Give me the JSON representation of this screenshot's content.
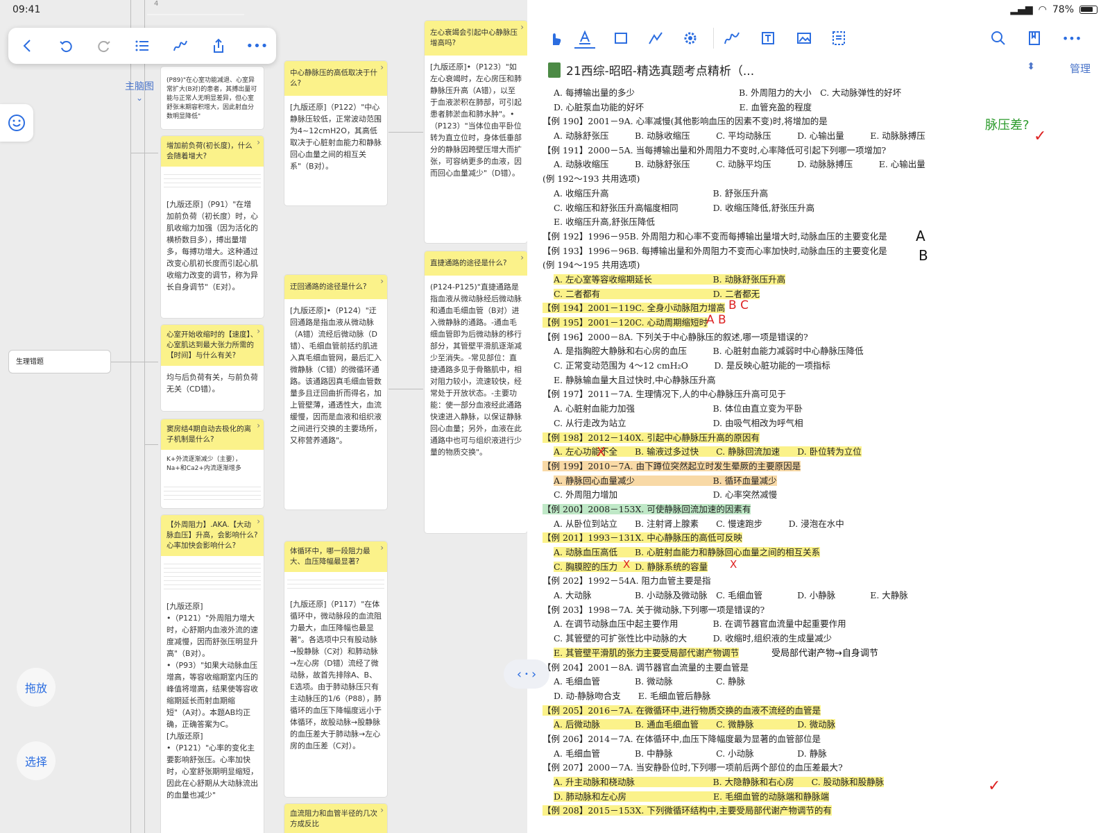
{
  "status": {
    "time": "09:41",
    "battery": "78%"
  },
  "canvas": {
    "mindmap_label": "主脑图",
    "topic_node": "生理错题",
    "drag_button": "拖放",
    "select_button": "选择",
    "top_number": "4"
  },
  "cards": {
    "c1": {
      "q": "",
      "a": "(P89)\"在心室功能减退、心室异常扩大(B对)的患者，其搏出量可能与正常人无明显差异，但心室舒张末期容积增大，因此射血分数明显降低\""
    },
    "c2": {
      "q": "增加前负荷(初长度)，什么会随着增大?",
      "a": "[九版还原]（P91）\"在增加前负荷（初长度）时，心肌收缩力加强（因为活化的横桥数目多），搏出量增多，每搏功增大。这种通过改变心肌初长度而引起心肌收缩力改变的调节，称为异长自身调节\"（E对）。"
    },
    "c3": {
      "q": "心室开始收缩时的【速度】、心室肌达到最大张力所需的【时间】与什么有关?",
      "a": "均与后负荷有关，与前负荷无关（CD错）。"
    },
    "c4": {
      "q": "窦房结4期自动去极化的离子机制是什么?",
      "a": "K+外流逐渐减少（主要），Na+和Ca2+内流逐渐增多"
    },
    "c5": {
      "q": "【外周阻力】.AKA.【大动脉血压】升高，会影响什么? 心率加快会影响什么?",
      "a1": "[九版还原]",
      "a2": "•（P121）\"外周阻力增大时，心舒期内血液外流的速度减慢，因而舒张压明显升高\"（B对）。",
      "a3": "•（P93）\"如果大动脉血压增高，等容收缩期室内压的峰值将增高，结果使等容收缩期延长而射血期缩短\"（A对）。本题AB均正确，正确答案为C。",
      "a4": "[九版还原]",
      "a5": "•（P121）\"心率的变化主要影响舒张压。心率加快时，心室舒张期明显缩短，因此在心舒期从大动脉流出的血量也减少\""
    },
    "c6": {
      "q": "中心静脉压的高低取决于什么?",
      "a": "[九版还原]（P122）\"中心静脉压较低，正常波动范围为4~12cmH2O，其高低取决于心脏射血能力和静脉回心血量之间的相互关系\"（B对）。"
    },
    "c7": {
      "q": "迂回通路的途径是什么?",
      "a": "[九版还原]•（P124）\"迂回通路是指血液从微动脉（A错）流经后微动脉（D错）、毛细血管前括约肌进入真毛细血管网，最后汇入微静脉（C错）的微循环通路。该通路因真毛细血管数量多且迂回曲折而得名，加上管壁薄，通透性大，血流缓慢，因而是血液和组织液之间进行交换的主要场所，又称营养通路\"。"
    },
    "c8": {
      "q": "体循环中，哪一段阻力最大、血压降幅最显著?",
      "a": "[九版还原]（P117）\"在体循环中，微动脉段的血流阻力最大，血压降幅也最显著\"。各选项中只有股动脉→股静脉（C对）和肺动脉→左心房（D错）流经了微动脉，故首先排除A、B、E选项。由于肺动脉压只有主动脉压的1/6（P88），肺循环的血压下降幅度远小于体循环，故股动脉→股静脉的血压差大于肺动脉→左心房的血压差（C对）。"
    },
    "c9": {
      "q": "血流阻力和血管半径的几次方成反比",
      "a": ""
    },
    "c10": {
      "q": "左心衰竭会引起中心静脉压增高吗?",
      "a": "[九版还原]•（P123）\"如左心衰竭时，左心房压和肺静脉压升高（A错），以至于血液淤积在肺部，可引起患者肺淤血和肺水肿\"。•（P123）\"当体位由平卧位转为直立位时，身体低垂部分的静脉因跨壁压增大而扩张，可容纳更多的血液，因而回心血量减少\"（D错）。"
    },
    "c11": {
      "q": "直捷通路的途径是什么?",
      "a": "(P124-P125)\"直捷通路是指血液从微动脉经后微动脉和通血毛细血管（B对）进入微静脉的通路。-通血毛细血管即为后微动脉的移行部分，其管壁平滑肌逐渐减少至消失。-常见部位：直捷通路多见于骨骼肌中，相对阻力较小，流速较快，经常处于开放状态。-主要功能：使一部分血液经此通路快速进入静脉，以保证静脉回心血量；另外，血液在此通路中也可与组织液进行少量的物质交换\"。"
    }
  },
  "pdf": {
    "title": "21西综-昭昭-精选真题考点精析（...",
    "manage": "管理",
    "lines": [
      "A. 每搏输出量的多少　　　　　　　　　　　　B. 外周阻力的大小　C. 大动脉弹性的好坏",
      "D. 心脏泵血功能的好坏　　　　　　　　　　　E. 血管充盈的程度",
      "【例 190】2001－9A. 心率减慢(其他影响血压的因素不变)时,将增加的是",
      "A. 动脉舒张压　　　B. 动脉收缩压　　　C. 平均动脉压　　　D. 心输出量　　　E. 动脉脉搏压",
      "【例 191】2000－5A. 当每搏输出量和外周阻力不变时,心率降低可引起下列哪一项增加?",
      "A. 动脉收缩压　　　B. 动脉舒张压　　　C. 动脉平均压　　　D. 动脉脉搏压　　　E. 心输出量",
      "(例 192～193 共用选项)",
      "A. 收缩压升高　　　　　　　　　　　　B. 舒张压升高",
      "C. 收缩压和舒张压升高幅度相同　　　　D. 收缩压降低,舒张压升高",
      "E. 收缩压升高,舒张压降低",
      "【例 192】1996－95B. 外周阻力和心率不变而每搏输出量增大时,动脉血压的主要变化是",
      "【例 193】1996－96B. 每搏输出量和外周阻力不变而心率加快时,动脉血压的主要变化是",
      "(例 194～195 共用选项)",
      "A. 左心室等容收缩期延长　　　　　　　B. 动脉舒张压升高",
      "C. 二者都有　　　　　　　　　　　　　D. 二者都无",
      "【例 194】2001－119C. 全身小动脉阻力增高",
      "【例 195】2001－120C. 心动周期缩短时",
      "【例 196】2000－8A. 下列关于中心静脉压的叙述,哪一项是错误的?",
      "A. 是指胸腔大静脉和右心房的血压　　　B. 心脏射血能力减弱时中心静脉压降低",
      "C. 正常变动范围为 4～12 cmH₂O　　　D. 是反映心脏功能的一项指标",
      "E. 静脉输血量大且过快时,中心静脉压升高",
      "【例 197】2011－7A. 生理情况下,人的中心静脉压升高可见于",
      "A. 心脏射血能力加强　　　　　　　　　B. 体位由直立变为平卧",
      "C. 从行走改为站立　　　　　　　　　　D. 由吸气相改为呼气相",
      "【例 198】2012－140X. 引起中心静脉压升高的原因有",
      "A. 左心功能不全　　B. 输液过多过快　　C. 静脉回流加速　　D. 卧位转为立位",
      "【例 199】2010－7A. 由下蹲位突然起立时发生晕厥的主要原因是",
      "A. 静脉回心血量减少　　　　　　　　　B. 循环血量减少",
      "C. 外周阻力增加　　　　　　　　　　　D. 心率突然减慢",
      "【例 200】2008－153X. 可使静脉回流加速的因素有",
      "A. 从卧位到站立　　B. 注射肾上腺素　　C. 慢速跑步　　　D. 浸泡在水中",
      "【例 201】1993－131X. 中心静脉压的高低可反映",
      "A. 动脉血压高低　　B. 心脏射血能力和静脉回心血量之间的相互关系",
      "C. 胸膜腔的压力　　D. 静脉系统的容量",
      "【例 202】1992－54A. 阻力血管主要是指",
      "A. 大动脉　　　　　B. 小动脉及微动脉　C. 毛细血管　　　　D. 小静脉　　　　E. 大静脉",
      "【例 203】1998－7A. 关于微动脉,下列哪一项是错误的?",
      "A. 在调节动脉血压中起主要作用　　　　B. 在调节器官血流量中起重要作用",
      "C. 其管壁的可扩张性比中动脉的大　　　D. 收缩时,组织液的生成量减少",
      "E. 其管壁平滑肌的张力主要受局部代谢产物调节",
      "【例 204】2001－8A. 调节器官血流量的主要血管是",
      "A. 毛细血管　　　　B. 微动脉　　　　　C. 静脉",
      "D. 动-静脉吻合支　　E. 毛细血管后静脉",
      "【例 205】2016－7A. 在微循环中,进行物质交换的血液不流经的血管是",
      "A. 后微动脉　　　　B. 通血毛细血管　　C. 微静脉　　　　　D. 微动脉",
      "【例 206】2014－7A. 在体循环中,血压下降幅度最为显著的血管部位是",
      "A. 毛细血管　　　　B. 中静脉　　　　　C. 小动脉　　　　　D. 静脉",
      "【例 207】2000－7A. 当安静卧位时,下列哪一项前后两个部位的血压差最大?",
      "A. 升主动脉和桡动脉　　　　　　　　　B. 大隐静脉和右心房　　C. 股动脉和股静脉",
      "D. 肺动脉和左心房　　　　　　　　　　E. 毛细血管的动脉端和静脉端",
      "【例 208】2015－153X. 下列微循环结构中,主要受局部代谢产物调节的有"
    ],
    "ink": {
      "pulse": "脉压差?",
      "a192": "A",
      "b193": "B",
      "bc194": "B C",
      "ab195": "A B",
      "note203": "受局部代谢产物→自身调节",
      "x": "X"
    }
  }
}
